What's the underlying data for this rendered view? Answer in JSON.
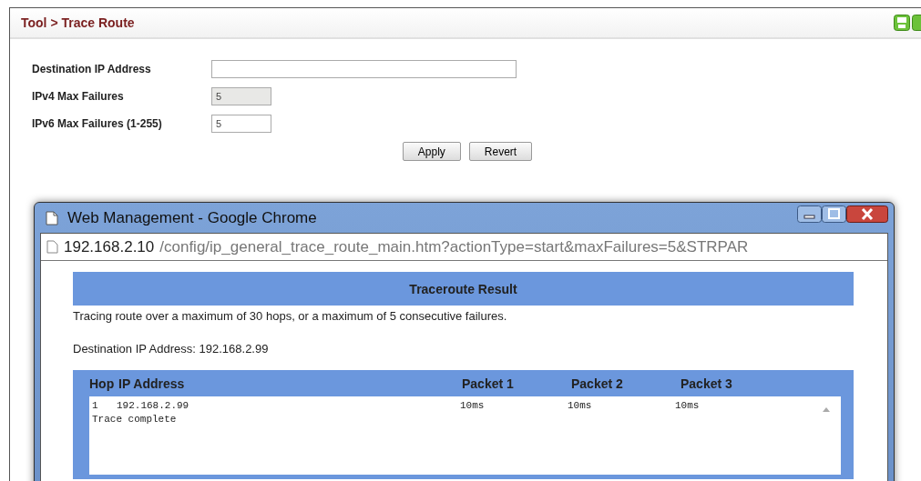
{
  "page": {
    "breadcrumb": "Tool > Trace Route",
    "fields": [
      {
        "label": "Destination IP Address",
        "kind": "wide",
        "disabled": false
      },
      {
        "label": "IPv4 Max Failures",
        "value": "5",
        "kind": "short",
        "disabled": true
      },
      {
        "label": "IPv6 Max Failures (1-255)",
        "value": "5",
        "kind": "short",
        "disabled": false
      }
    ],
    "buttons": [
      "Apply",
      "Revert"
    ]
  },
  "popup": {
    "title": "Web Management - Google Chrome",
    "url_host": "192.168.2.10",
    "url_path": "/config/ip_general_trace_route_main.htm?actionType=start&maxFailures=5&STRPAR",
    "result_title": "Traceroute Result",
    "summary": "Tracing route over a maximum of 30 hops, or a maximum of 5 consecutive failures.",
    "destination_label": "Destination IP Address:",
    "destination_value": "192.168.2.99",
    "columns": [
      "Hop",
      "IP Address",
      "Packet 1",
      "Packet 2",
      "Packet 3"
    ],
    "rows": [
      {
        "hop": "1",
        "ip": "192.168.2.99",
        "packets": [
          "10ms",
          "10ms",
          "10ms"
        ]
      }
    ],
    "status": "Trace complete"
  }
}
